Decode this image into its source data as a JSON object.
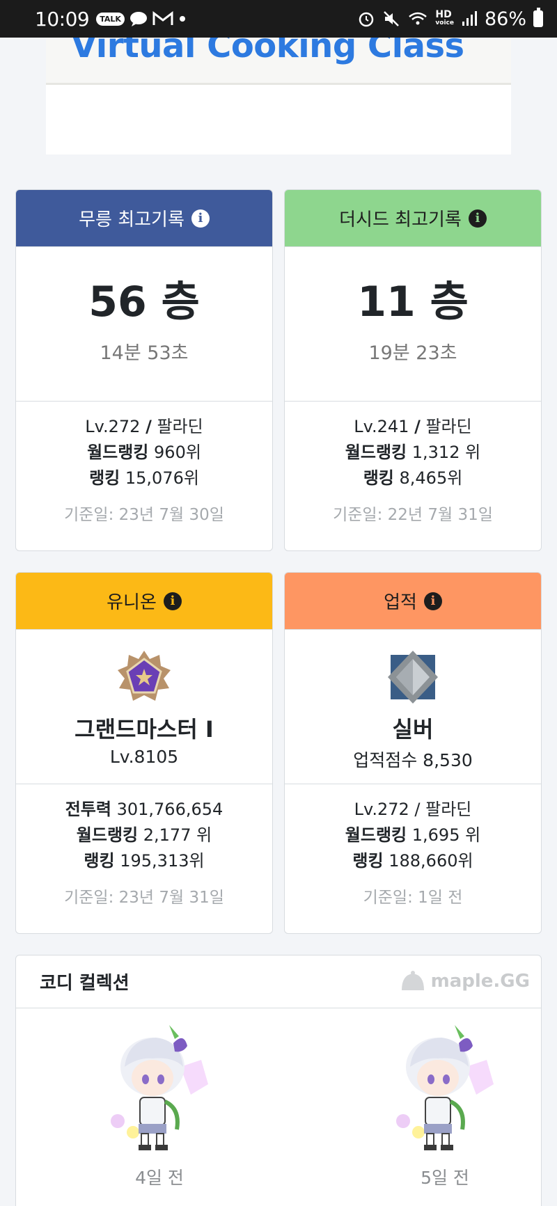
{
  "status_bar": {
    "time": "10:09",
    "battery": "86%",
    "talk_badge": "TALK",
    "hd_label": "HD",
    "voice_label": "voice"
  },
  "ad": {
    "title": "Virtual Cooking Class"
  },
  "cards": {
    "mureung": {
      "title": "무릉 최고기록",
      "floor": "56 층",
      "time": "14분 53초",
      "level_prefix": "Lv.272",
      "level_sep": "/",
      "job": "팔라딘",
      "world_rank_label": "월드랭킹",
      "world_rank_value": "960위",
      "rank_label": "랭킹",
      "rank_value": "15,076위",
      "date": "기준일: 23년 7월 30일",
      "head_color": "#3f5a9b"
    },
    "theseed": {
      "title": "더시드 최고기록",
      "floor": "11 층",
      "time": "19분 23초",
      "level_prefix": "Lv.241",
      "level_sep": "/",
      "job": "팔라딘",
      "world_rank_label": "월드랭킹",
      "world_rank_value": "1,312 위",
      "rank_label": "랭킹",
      "rank_value": "8,465위",
      "date": "기준일: 22년 7월 31일",
      "head_color": "#8ed68e"
    },
    "union": {
      "title": "유니온",
      "emblem_icon": "grandmaster-emblem-icon",
      "tier": "그랜드마스터 I",
      "level": "Lv.8105",
      "power_label": "전투력",
      "power_value": "301,766,654",
      "world_rank_label": "월드랭킹",
      "world_rank_value": "2,177 위",
      "rank_label": "랭킹",
      "rank_value": "195,313위",
      "date": "기준일: 23년 7월 31일",
      "head_color": "#fcb916"
    },
    "achievement": {
      "title": "업적",
      "emblem_icon": "silver-emblem-icon",
      "tier": "실버",
      "score": "업적점수 8,530",
      "level": "Lv.272 / 팔라딘",
      "world_rank_label": "월드랭킹",
      "world_rank_value": "1,695 위",
      "rank_label": "랭킹",
      "rank_value": "188,660위",
      "date": "기준일: 1일 전",
      "head_color": "#fe9662"
    }
  },
  "coordi": {
    "title": "코디 컬렉션",
    "watermark": "maple.GG",
    "items": [
      {
        "caption": "4일 전"
      },
      {
        "caption": "5일 전"
      }
    ]
  }
}
